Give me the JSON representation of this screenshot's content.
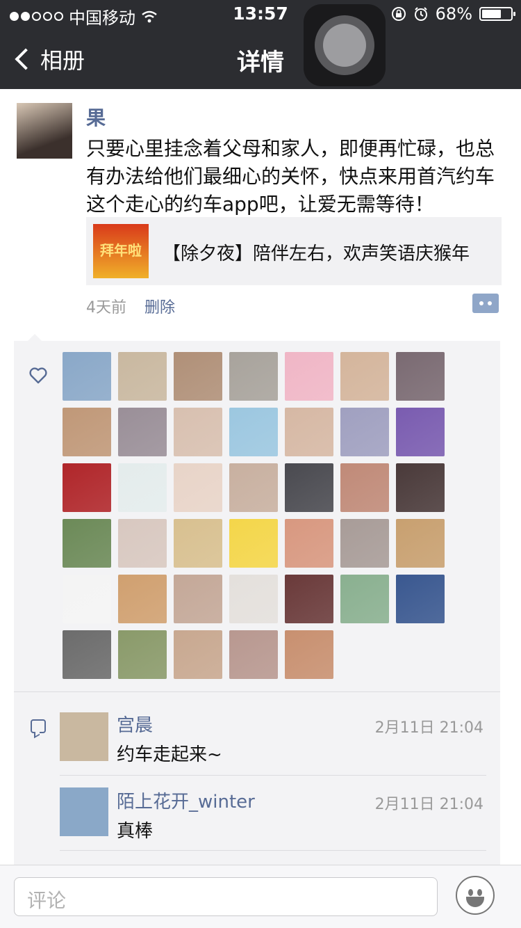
{
  "status_bar": {
    "carrier": "中国移动",
    "time": "13:57",
    "battery": "68%",
    "battery_level": 0.68
  },
  "nav": {
    "back_label": "相册",
    "title": "详情"
  },
  "post": {
    "author": "果",
    "text": "只要心里挂念着父母和家人，即便再忙碌，也总有办法给他们最细心的关怀，快点来用首汽约车 这个走心的约车app吧，让爱无需等待！",
    "link_card": {
      "title": "【除夕夜】陪伴左右，欢声笑语庆猴年",
      "thumb_text": "拜年啦"
    },
    "time_ago": "4天前",
    "delete_label": "删除"
  },
  "likes": {
    "rows": [
      [
        "#8aa8c8",
        "#c9b8a0",
        "#b09078",
        "#a8a39c",
        "#f0b6c6",
        "#d4b59c",
        "#7a6a72"
      ],
      [
        "#c09878",
        "#9a8f98",
        "#d8c0b0",
        "#9cc7e0",
        "#d6b8a4",
        "#a0a0c0",
        "#7a5cb0"
      ],
      [
        "#b0262a",
        "#e4ecec",
        "#e8d4c8",
        "#c8b0a0",
        "#4a4a50",
        "#c08a78",
        "#4a3a3a"
      ],
      [
        "#6c8a58",
        "#d8c8c0",
        "#d8c090",
        "#f4d64a",
        "#d89880",
        "#a89c98",
        "#c8a070"
      ],
      [
        "#f4f4f4",
        "#d0a070",
        "#c4a898",
        "#e4e0dc",
        "#6a3a3a",
        "#8ab090",
        "#3a5890"
      ],
      [
        "#6c6c6c",
        "#8a9a6a",
        "#c8a890",
        "#b89890",
        "#c89070"
      ]
    ]
  },
  "comments": [
    {
      "name": "宫晨",
      "time": "2月11日 21:04",
      "text": "约车走起来~",
      "avatar_color": "#c9b8a0"
    },
    {
      "name": "陌上花开_winter",
      "time": "2月11日 21:04",
      "text": "真棒",
      "avatar_color": "#8aa8c8"
    }
  ],
  "input": {
    "placeholder": "评论"
  },
  "colors": {
    "link_blue": "#576b95",
    "topbar": "#2c2d31",
    "panel_bg": "#f3f3f5"
  },
  "icons": [
    "wifi-icon",
    "lock-rotation-icon",
    "alarm-icon",
    "battery-icon",
    "back-chevron-icon",
    "assistive-touch-icon",
    "more-comment-icon",
    "heart-icon",
    "comment-icon",
    "emoji-icon"
  ]
}
